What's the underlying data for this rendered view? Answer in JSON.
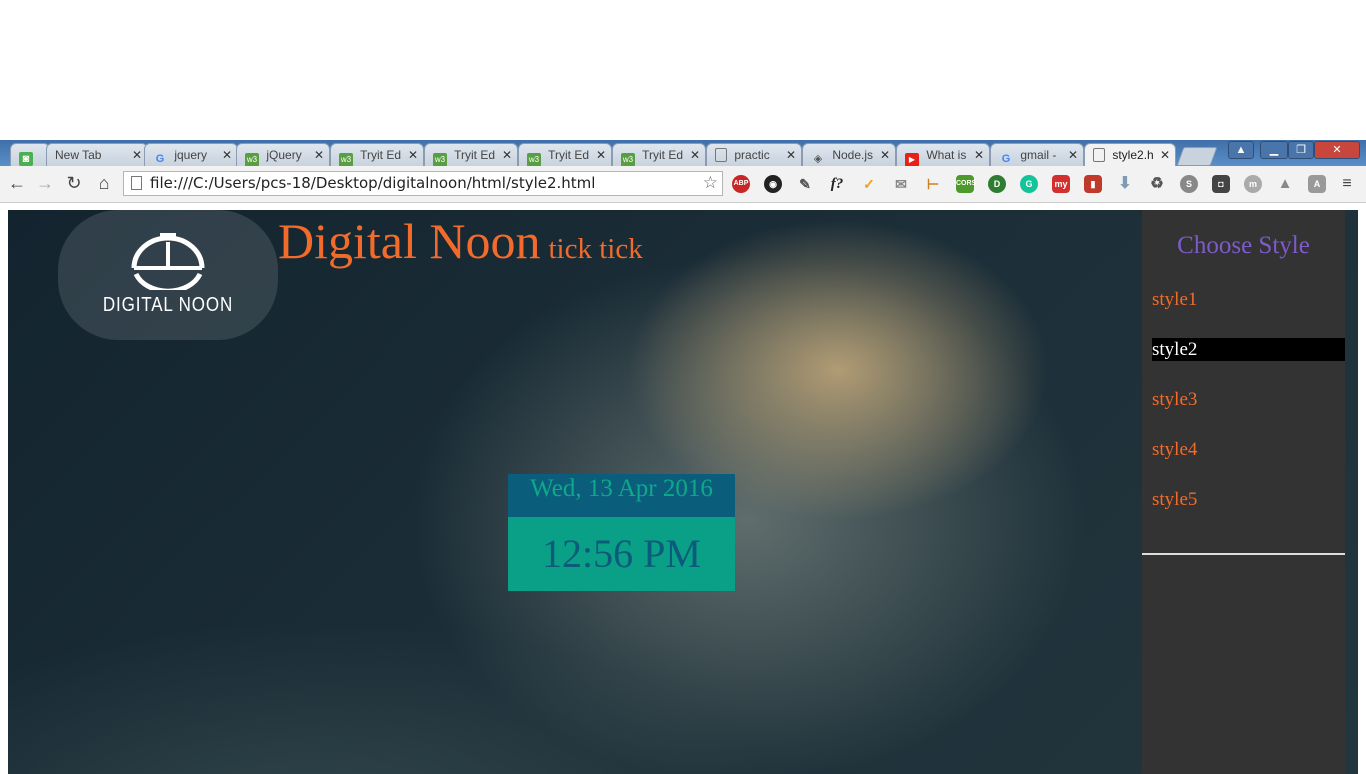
{
  "browser": {
    "tabs": [
      {
        "label": "",
        "icon": "app-icon",
        "icon_color": "#4caf50"
      },
      {
        "label": "New Tab",
        "icon": "none"
      },
      {
        "label": "jquery",
        "icon": "google-icon"
      },
      {
        "label": "jQuery",
        "icon": "w3schools-icon"
      },
      {
        "label": "Tryit Ed",
        "icon": "w3schools-icon"
      },
      {
        "label": "Tryit Ed",
        "icon": "w3schools-icon"
      },
      {
        "label": "Tryit Ed",
        "icon": "w3schools-icon"
      },
      {
        "label": "Tryit Ed",
        "icon": "w3schools-icon"
      },
      {
        "label": "practic",
        "icon": "page-icon"
      },
      {
        "label": "Node.js",
        "icon": "nodejs-icon"
      },
      {
        "label": "What is",
        "icon": "youtube-icon"
      },
      {
        "label": "gmail -",
        "icon": "google-icon"
      },
      {
        "label": "style2.h",
        "icon": "page-icon",
        "active": true
      }
    ],
    "address": "file:///C:/Users/pcs-18/Desktop/digitalnoon/html/style2.html",
    "extensions": [
      "ABP",
      "colorzilla",
      "eyedropper",
      "f?",
      "check",
      "mail",
      "ruler",
      "CORS",
      "counter",
      "grammarly",
      "my",
      "book",
      "download",
      "recycle",
      "skype",
      "shield",
      "m",
      "drive",
      "angular",
      "menu"
    ]
  },
  "page": {
    "logo_text": "DIGITAL NOON",
    "title": "Digital Noon",
    "subtitle": "tick tick",
    "clock": {
      "date": "Wed, 13 Apr 2016",
      "time": "12:56 PM"
    },
    "style_panel": {
      "title": "Choose Style",
      "items": [
        "style1",
        "style2",
        "style3",
        "style4",
        "style5"
      ],
      "active_index": 1
    }
  },
  "colors": {
    "accent_orange": "#f26b2b",
    "panel_title_purple": "#7e5acb",
    "clock_date_bg": "#0b5e7b",
    "clock_time_bg": "#0aa087"
  }
}
